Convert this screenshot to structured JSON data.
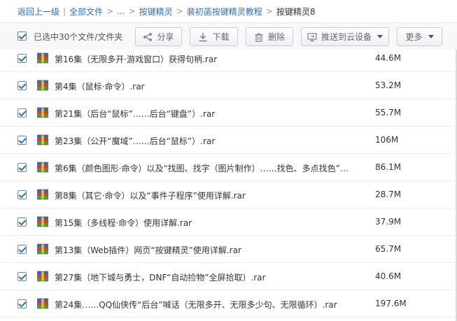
{
  "breadcrumb": {
    "back": "返回上一级",
    "all_files": "全部文件",
    "ellipsis": "...",
    "level1": "按键精灵",
    "level2": "裴初菡按键精灵教程",
    "current": "按键精灵8",
    "separator": ">"
  },
  "toolbar": {
    "selection_text": "已选中30个文件/文件夹",
    "share_label": "分享",
    "download_label": "下载",
    "delete_label": "删除",
    "push_label": "推送到云设备",
    "more_label": "更多"
  },
  "files": [
    {
      "name": "第16集（无限多开·游戏窗口）获得句柄.rar",
      "size": "44.6M"
    },
    {
      "name": "第4集（鼠标·命令）.rar",
      "size": "53.2M"
    },
    {
      "name": "第21集（后台“鼠标”……后台“键盘”）.rar",
      "size": "55.7M"
    },
    {
      "name": "第23集（公开“魔域”……后台“鼠标”）.rar",
      "size": "106M"
    },
    {
      "name": "第6集（颜色图形·命令）以及“找图、找字（图片制作）……找色、多点找色”…",
      "size": "86.1M"
    },
    {
      "name": "第8集（其它·命令）以及“事件子程序”使用详解.rar",
      "size": "28.7M"
    },
    {
      "name": "第15集（多线程·命令）使用详解.rar",
      "size": "37.9M"
    },
    {
      "name": "第13集（Web插件）网页“按键精灵”使用详解.rar",
      "size": "65.7M"
    },
    {
      "name": "第27集（地下城与勇士，DNF“自动捡物”全屏拾取）.rar",
      "size": "40.6M"
    },
    {
      "name": "第24集……QQ仙侠传“后台”喊话（无限多开、无限多少句、无限循环）.rar",
      "size": "197.6M"
    }
  ],
  "icons": {
    "share": "share-icon",
    "download": "download-icon",
    "delete": "trash-icon",
    "push": "device-icon",
    "file": "rar-archive-icon"
  },
  "colors": {
    "link": "#2a6fc1",
    "toolbar_bg": "#f7f8fa",
    "checkbox": "#2f6fb7"
  }
}
